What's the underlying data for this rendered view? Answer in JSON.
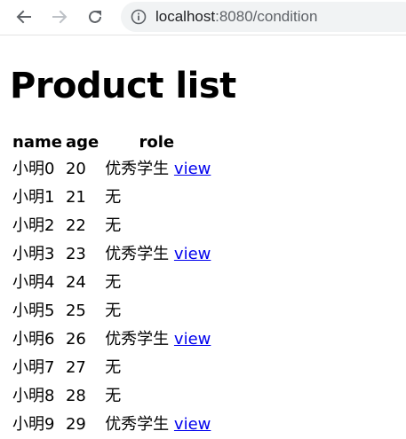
{
  "browser": {
    "url_host": "localhost",
    "url_rest": ":8080/condition",
    "icons": {
      "back": "back-arrow-icon",
      "forward": "forward-arrow-icon",
      "reload": "reload-icon",
      "site_info": "info-icon"
    }
  },
  "page": {
    "title": "Product list",
    "table": {
      "headers": [
        "name",
        "age",
        "role"
      ],
      "rows": [
        {
          "name": "小明0",
          "age": "20",
          "role": "优秀学生",
          "link": "view"
        },
        {
          "name": "小明1",
          "age": "21",
          "role": "无",
          "link": ""
        },
        {
          "name": "小明2",
          "age": "22",
          "role": "无",
          "link": ""
        },
        {
          "name": "小明3",
          "age": "23",
          "role": "优秀学生",
          "link": "view"
        },
        {
          "name": "小明4",
          "age": "24",
          "role": "无",
          "link": ""
        },
        {
          "name": "小明5",
          "age": "25",
          "role": "无",
          "link": ""
        },
        {
          "name": "小明6",
          "age": "26",
          "role": "优秀学生",
          "link": "view"
        },
        {
          "name": "小明7",
          "age": "27",
          "role": "无",
          "link": ""
        },
        {
          "name": "小明8",
          "age": "28",
          "role": "无",
          "link": ""
        },
        {
          "name": "小明9",
          "age": "29",
          "role": "优秀学生",
          "link": "view"
        }
      ]
    }
  },
  "colors": {
    "link": "#0000ee",
    "omnibox_bg": "#f1f3f4",
    "icon": "#5f6368",
    "icon_disabled": "#bdc1c6"
  }
}
